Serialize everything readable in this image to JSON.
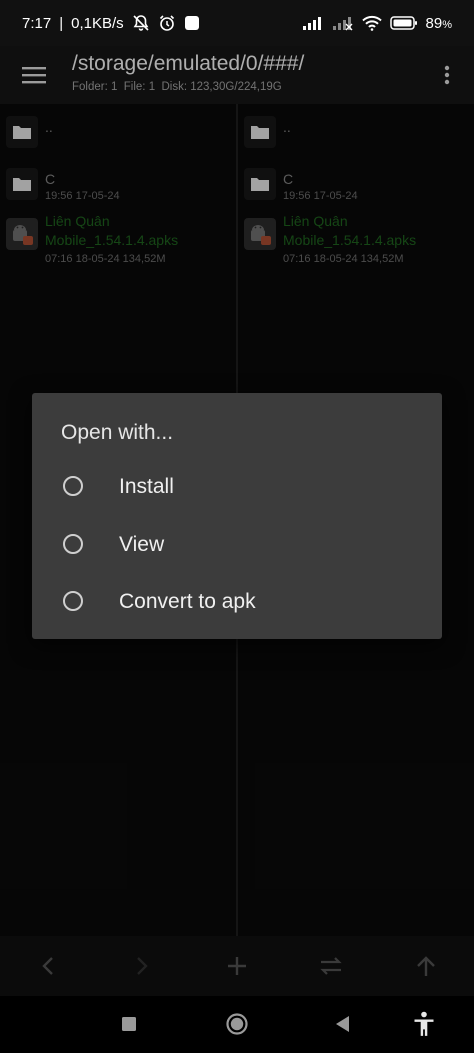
{
  "status_bar": {
    "time": "7:17",
    "network_speed": "0,1KB/s",
    "icons": [
      "notifications-off-icon",
      "alarm-icon",
      "app-notification-icon",
      "signal-icon",
      "signal-weak-icon",
      "wifi-icon",
      "battery-icon"
    ],
    "battery_percent": "89",
    "battery_unit": "%"
  },
  "app_bar": {
    "path": "/storage/emulated/0/###/",
    "folder_count": "Folder: 1",
    "file_count": "File: 1",
    "disk": "Disk: 123,30G/224,19G"
  },
  "panes": [
    {
      "items": [
        {
          "name": "..",
          "meta": "",
          "type": "parent",
          "icon": "folder-icon"
        },
        {
          "name": "C",
          "meta": "19:56 17-05-24",
          "type": "folder",
          "icon": "folder-icon"
        },
        {
          "name": "Liên Quân Mobile_1.54.1.4.apks",
          "name_line1": "Liên Quân",
          "name_line2": "Mobile_1.54.1.4.apks",
          "meta": "07:16 18-05-24 134,52M",
          "type": "apk",
          "icon": "android-apk-icon"
        }
      ]
    },
    {
      "items": [
        {
          "name": "..",
          "meta": "",
          "type": "parent",
          "icon": "folder-icon"
        },
        {
          "name": "C",
          "meta": "19:56 17-05-24",
          "type": "folder",
          "icon": "folder-icon"
        },
        {
          "name": "Liên Quân Mobile_1.54.1.4.apks",
          "name_line1": "Liên Quân",
          "name_line2": "Mobile_1.54.1.4.apks",
          "meta": "07:16 18-05-24 134,52M",
          "type": "apk",
          "icon": "android-apk-icon"
        }
      ]
    }
  ],
  "dialog": {
    "title": "Open with...",
    "options": [
      {
        "label": "Install",
        "selected": false
      },
      {
        "label": "View",
        "selected": false
      },
      {
        "label": "Convert to apk",
        "selected": false
      }
    ]
  },
  "toolbar": {
    "buttons": [
      "back-arrow-icon",
      "forward-arrow-icon",
      "add-icon",
      "swap-panes-icon",
      "up-arrow-icon"
    ]
  },
  "nav_bar": {
    "buttons": [
      "recents-square-icon",
      "home-circle-icon",
      "back-triangle-icon",
      "accessibility-icon"
    ]
  },
  "colors": {
    "dialog_bg": "#3c3c3c",
    "apk_name": "#1d5e1d",
    "background": "#0d0d0d"
  }
}
